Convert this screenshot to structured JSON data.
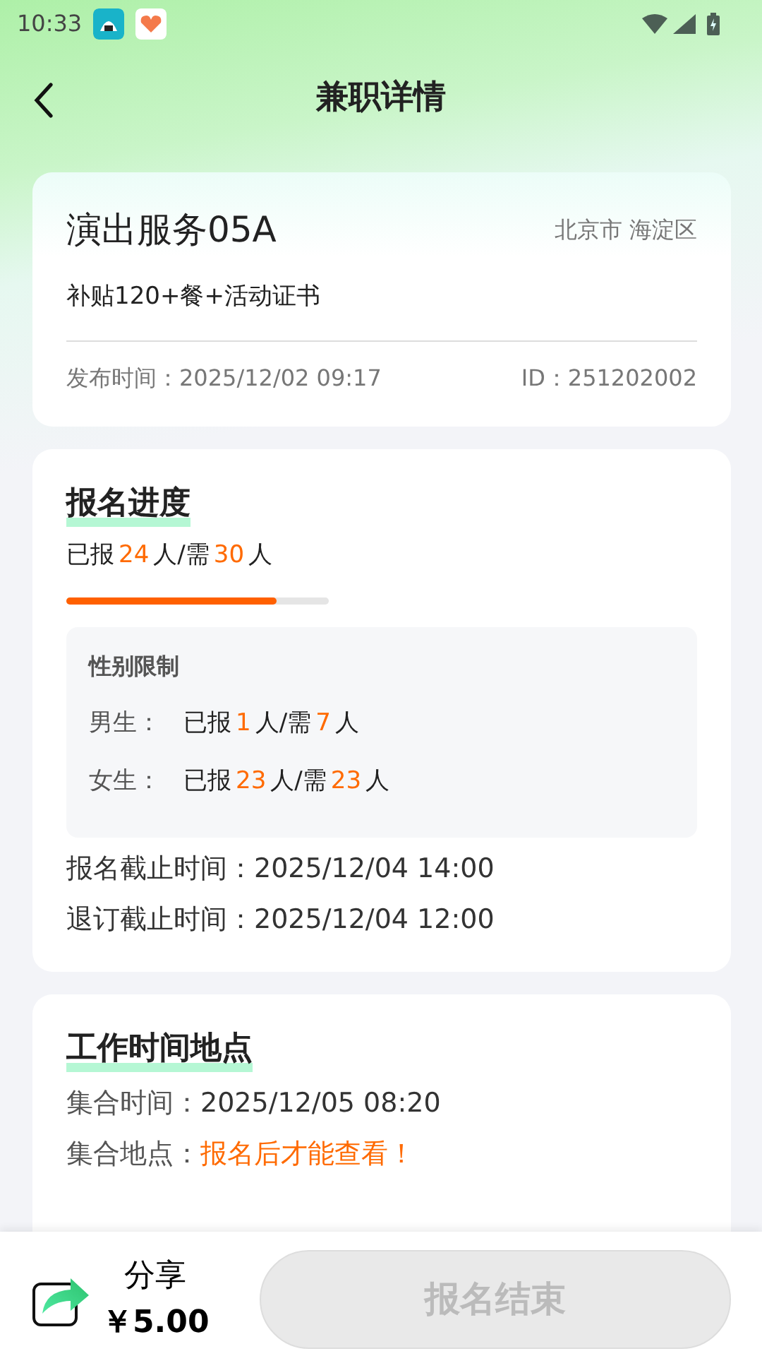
{
  "status_bar": {
    "time": "10:33"
  },
  "header": {
    "title": "兼职详情"
  },
  "job": {
    "title": "演出服务05A",
    "location": "北京市 海淀区",
    "benefits": "补贴120+餐+活动证书",
    "published_label": "发布时间：",
    "published": "2025/12/02 09:17",
    "id": "ID：251202002"
  },
  "signup": {
    "heading": "报名进度",
    "summary": [
      {
        "text": "已报",
        "highlight": false
      },
      {
        "text": "24",
        "highlight": true
      },
      {
        "text": "人/需",
        "highlight": false
      },
      {
        "text": "30",
        "highlight": true
      },
      {
        "text": "人",
        "highlight": false
      }
    ],
    "level": 0.8,
    "gender_title": "性别限制",
    "genders": [
      {
        "label": "男生：",
        "parts": [
          {
            "text": "已报",
            "highlight": false
          },
          {
            "text": "1",
            "highlight": true
          },
          {
            "text": "人/需",
            "highlight": false
          },
          {
            "text": "7",
            "highlight": true
          },
          {
            "text": "人",
            "highlight": false
          }
        ]
      },
      {
        "label": "女生：",
        "parts": [
          {
            "text": "已报",
            "highlight": false
          },
          {
            "text": "23",
            "highlight": true
          },
          {
            "text": "人/需",
            "highlight": false
          },
          {
            "text": "23",
            "highlight": true
          },
          {
            "text": "人",
            "highlight": false
          }
        ]
      }
    ],
    "deadlines": [
      {
        "label": "报名截止时间：",
        "value": "2025/12/04 14:00"
      },
      {
        "label": "退订截止时间：",
        "value": "2025/12/04 12:00"
      }
    ]
  },
  "work": {
    "heading": "工作时间地点",
    "rows": [
      {
        "label": "集合时间：",
        "value": "2025/12/05 08:20",
        "highlight": false
      },
      {
        "label": "集合地点：",
        "value": "报名后才能查看！",
        "highlight": true
      }
    ]
  },
  "bottom_bar": {
    "share": "分享",
    "reward": "￥5.00",
    "action": "报名结束",
    "disabled": true
  }
}
